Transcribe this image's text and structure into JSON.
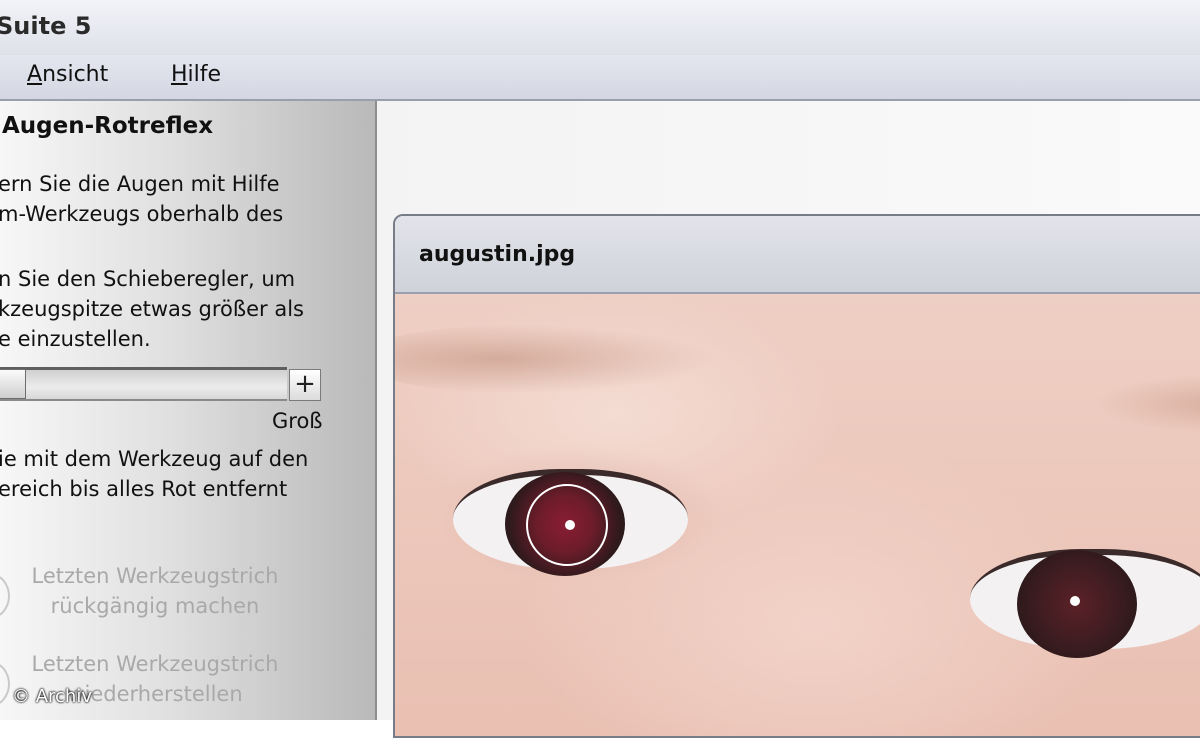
{
  "window": {
    "title": "Suite 5"
  },
  "menu": {
    "items": [
      {
        "label_ul": "A",
        "label_rest": "nsicht"
      },
      {
        "label_ul": "H",
        "label_rest": "ilfe"
      }
    ]
  },
  "panel": {
    "title": "Augen-Rotreflex",
    "paragraph1": "ern Sie die Augen mit Hilfe\nm-Werkzeugs oberhalb des",
    "paragraph2": "n Sie den Schieberegler, um\nkzeugspitze etwas größer als\ne einzustellen.",
    "slider": {
      "plus_label": "+",
      "max_label": "Groß",
      "value_percent": 0
    },
    "paragraph3": "ie mit dem Werkzeug auf den\nereich bis alles Rot entfernt",
    "actions": [
      {
        "label": "Letzten Werkzeugstrich\nrückgängig machen",
        "enabled": false
      },
      {
        "label": "Letzten Werkzeugstrich\nwiederherstellen",
        "enabled": false
      }
    ]
  },
  "document": {
    "title": "augustin.jpg"
  },
  "watermark": "© Archiv",
  "colors": {
    "accent_red_eye": "#8a1d34",
    "panel_gray": "#d0d0d0"
  }
}
